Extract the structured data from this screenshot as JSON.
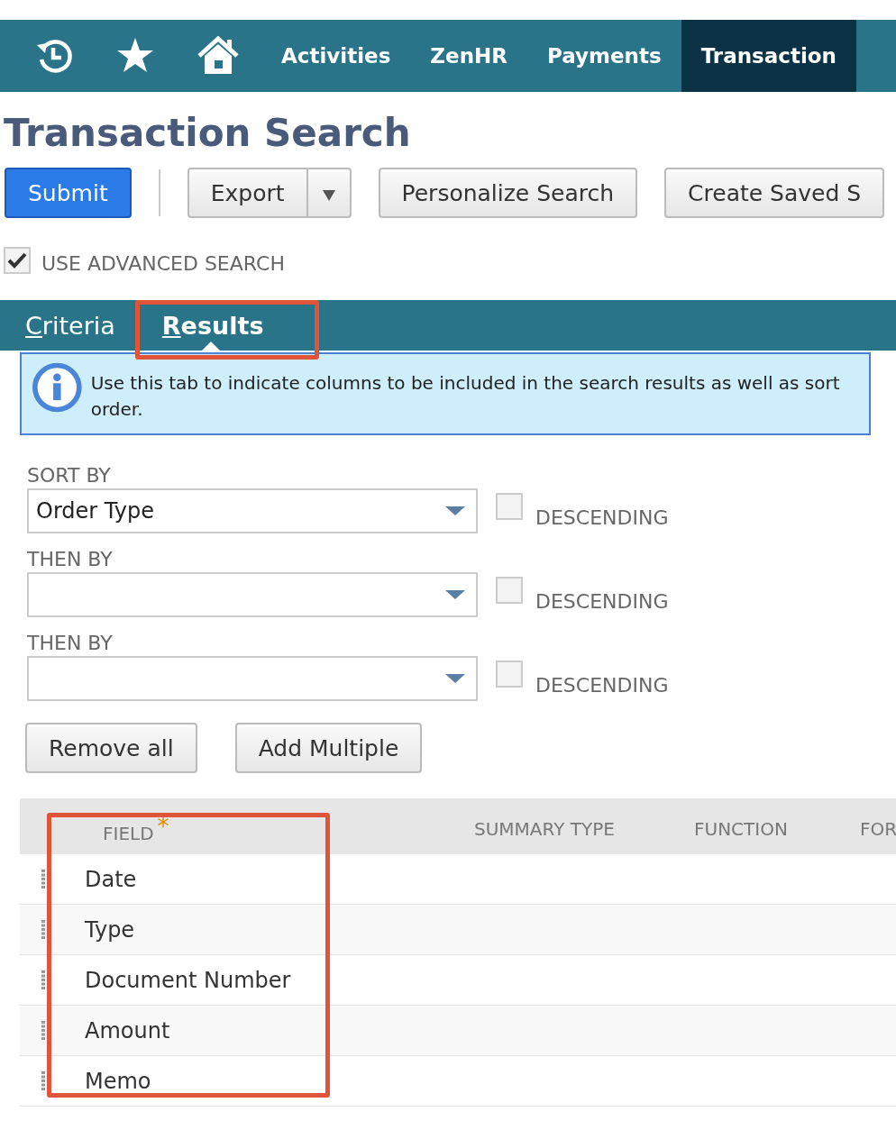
{
  "nav": {
    "icons": [
      {
        "kind": "recent"
      },
      {
        "kind": "favorites"
      },
      {
        "kind": "home"
      }
    ],
    "items": [
      {
        "label": "Activities",
        "selected": false
      },
      {
        "label": "ZenHR",
        "selected": false
      },
      {
        "label": "Payments",
        "selected": false
      },
      {
        "label": "Transaction",
        "selected": true
      }
    ]
  },
  "title": "Transaction Search",
  "toolbar": [
    {
      "kind": "primary",
      "label": "Submit"
    },
    {
      "kind": "split",
      "label": "Export"
    },
    {
      "kind": "plain",
      "label": "Personalize Search"
    },
    {
      "kind": "plain",
      "label": "Create Saved S"
    }
  ],
  "advanced": {
    "label": "USE ADVANCED SEARCH",
    "checked": true
  },
  "tabs": [
    {
      "label": "Criteria",
      "selected": false,
      "highlighted": false
    },
    {
      "label": "Results",
      "selected": true,
      "highlighted": true
    }
  ],
  "info": "Use this tab to indicate columns to be included in the search results as well as sort order.",
  "sorts": [
    {
      "label": "SORT BY",
      "value": "Order Type",
      "descending_label": "DESCENDING",
      "descending": false
    },
    {
      "label": "THEN BY",
      "descending_label": "DESCENDING",
      "descending": false
    },
    {
      "label": "THEN BY",
      "descending_label": "DESCENDING",
      "descending": false
    }
  ],
  "actions": [
    "Remove all",
    "Add Multiple"
  ],
  "table": {
    "field_highlighted": true,
    "columns": [
      {
        "label": "FIELD",
        "marker": "*"
      },
      {
        "label": "SUMMARY TYPE"
      },
      {
        "label": "FUNCTION"
      },
      {
        "label": "FOR"
      }
    ],
    "rows": [
      "Date",
      "Type",
      "Document Number",
      "Amount",
      "Memo"
    ]
  }
}
